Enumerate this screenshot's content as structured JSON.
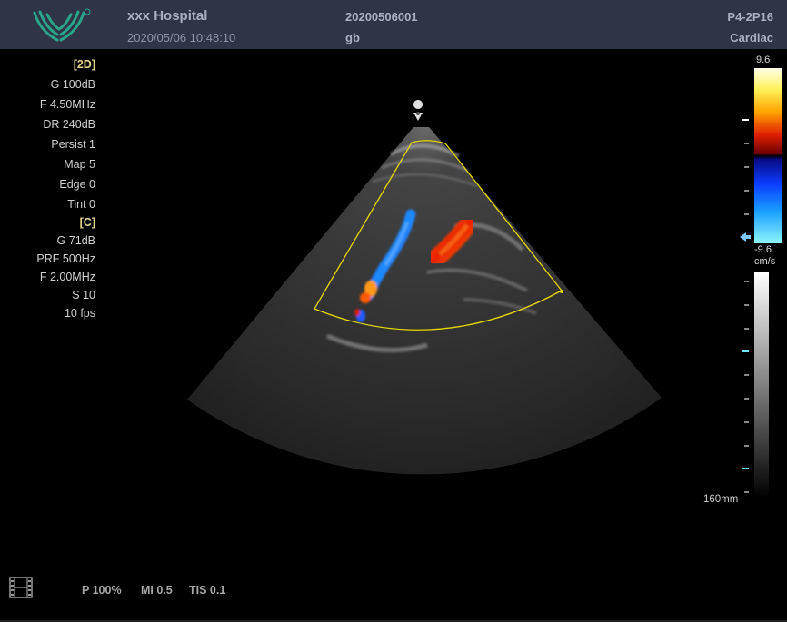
{
  "header": {
    "hospital": "xxx Hospital",
    "datetime": "2020/05/06 10:48:10",
    "patient_id": "20200506001",
    "patient_name": "gb",
    "probe": "P4-2P16",
    "preset": "Cardiac"
  },
  "params_2d": {
    "title": "[2D]",
    "items": [
      "G 100dB",
      "F 4.50MHz",
      "DR 240dB",
      "Persist 1",
      "Map 5",
      "Edge 0",
      "Tint 0"
    ]
  },
  "params_color": {
    "title": "[C]",
    "items": [
      "G 71dB",
      "PRF 500Hz",
      "F 2.00MHz",
      "S 10",
      "10 fps"
    ]
  },
  "colorbar": {
    "max": "9.6",
    "min": "-9.6",
    "unit": "cm/s"
  },
  "depth": "160mm",
  "footer": {
    "power": "P 100%",
    "mi": "MI 0.5",
    "tis": "TIS 0.1"
  },
  "colors": {
    "header_bg": "#2f3547",
    "roi": "#e6d800",
    "logo": "#2aa58a"
  },
  "icons": {
    "logo": "wing-logo-icon",
    "focus": "location-pin-icon",
    "cine": "film-strip-icon",
    "baseline": "arrow-left-icon"
  }
}
